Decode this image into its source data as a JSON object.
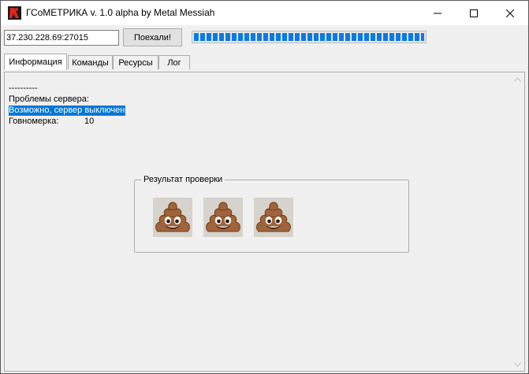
{
  "window": {
    "title": "ГСоМЕТРИКА v. 1.0 alpha by Metal Messiah"
  },
  "toolbar": {
    "address_value": "37.230.228.69:27015",
    "go_label": "Поехали!",
    "progress_percent": 100
  },
  "tabs": [
    {
      "label": "Информация"
    },
    {
      "label": "Команды"
    },
    {
      "label": "Ресурсы"
    },
    {
      "label": "Лог"
    }
  ],
  "info": {
    "separator": "----------",
    "problems_label": "Проблемы сервера:",
    "problem_text": "Возможно, сервер выключен",
    "score_label": "Говномерка:",
    "score_value": "10"
  },
  "result": {
    "legend": "Результат проверки",
    "icons": [
      "pile-of-poo-icon",
      "pile-of-poo-icon",
      "pile-of-poo-icon"
    ]
  },
  "colors": {
    "selection": "#0078d7",
    "progress": "#0a7ae6"
  }
}
